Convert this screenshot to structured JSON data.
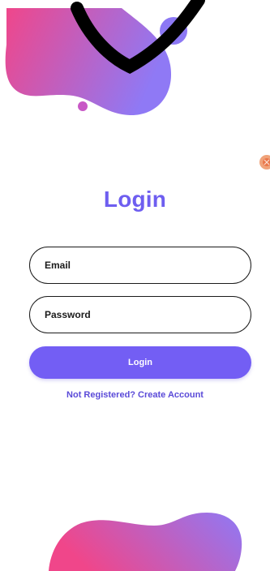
{
  "colors": {
    "accent": "#735ef4",
    "title": "#6e5ef0",
    "link": "#5a4ad8",
    "blob_start": "#f0468a",
    "blob_end": "#8f79f5",
    "field_border": "#1b1b1b"
  },
  "login": {
    "title": "Login",
    "email_placeholder": "Email",
    "password_placeholder": "Password",
    "submit_label": "Login",
    "register_link": "Not Registered? Create Account"
  },
  "decorations": {
    "top_blob": "blob-decoration",
    "bottom_blob": "blob-decoration",
    "corner_badge": "badge-icon"
  }
}
